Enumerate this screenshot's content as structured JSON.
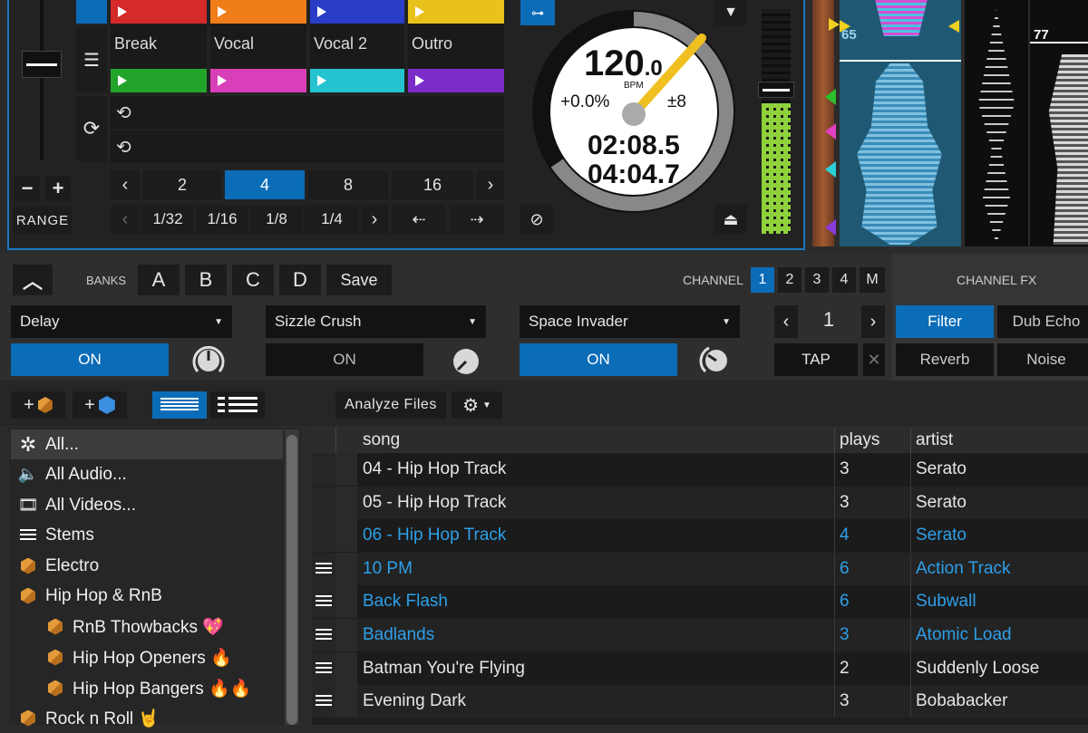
{
  "deck": {
    "cue_labels": [
      "Break",
      "Vocal",
      "Vocal 2",
      "Outro"
    ],
    "cue_colors": {
      "top": [
        "#d42a2a",
        "#f07d1a",
        "#2a3dc7",
        "#e8c21a"
      ],
      "bottom": [
        "#22a32a",
        "#d93fb8",
        "#24c3cf",
        "#7b2cc9"
      ]
    },
    "loop_sizes": [
      "2",
      "4",
      "8",
      "16"
    ],
    "loop_fractions": [
      "1/32",
      "1/16",
      "1/8",
      "1/4"
    ],
    "range_label": "RANGE",
    "minus_label": "−",
    "plus_label": "+",
    "bpm": "120",
    "bpm_decimal": ".0",
    "bpm_unit": "BPM",
    "pitch": "+0.0%",
    "pitch_range": "±8",
    "elapsed": "02:08.5",
    "remaining": "04:04.7"
  },
  "waveform": {
    "marker_left": "65",
    "marker_right": "77"
  },
  "fx": {
    "banks_label": "BANKS",
    "banks": [
      "A",
      "B",
      "C",
      "D"
    ],
    "save_label": "Save",
    "channel_label": "CHANNEL",
    "channels": [
      "1",
      "2",
      "3",
      "4",
      "M"
    ],
    "channel_fx_label": "CHANNEL FX",
    "units": [
      {
        "name": "Delay",
        "state": "ON",
        "active": true
      },
      {
        "name": "Sizzle Crush",
        "state": "ON",
        "active": false
      },
      {
        "name": "Space Invader",
        "state": "ON",
        "active": true
      }
    ],
    "beat_value": "1",
    "tap_label": "TAP",
    "channel_fx": [
      "Filter",
      "Dub Echo",
      "Reverb",
      "Noise"
    ]
  },
  "toolbar": {
    "analyze_label": "Analyze Files"
  },
  "library": {
    "items": [
      {
        "label": "All...",
        "icon": "asterisk-icon",
        "indent": 0
      },
      {
        "label": "All Audio...",
        "icon": "speaker-icon",
        "indent": 0
      },
      {
        "label": "All Videos...",
        "icon": "film-icon",
        "indent": 0
      },
      {
        "label": "Stems",
        "icon": "stems-icon",
        "indent": 0
      },
      {
        "label": "Electro",
        "icon": "crate-icon",
        "indent": 0
      },
      {
        "label": "Hip Hop & RnB",
        "icon": "crate-icon",
        "indent": 0
      },
      {
        "label": "RnB Thowbacks 💖",
        "icon": "crate-icon",
        "indent": 1
      },
      {
        "label": "Hip Hop Openers 🔥",
        "icon": "crate-icon",
        "indent": 1
      },
      {
        "label": "Hip Hop Bangers 🔥🔥",
        "icon": "crate-icon",
        "indent": 1
      },
      {
        "label": "Rock n Roll 🤘",
        "icon": "crate-icon",
        "indent": 0
      }
    ]
  },
  "tracks": {
    "headers": {
      "song": "song",
      "plays": "plays",
      "artist": "artist"
    },
    "rows": [
      {
        "song": "04 - Hip Hop Track",
        "plays": "3",
        "artist": "Serato",
        "highlight": false,
        "stems": false
      },
      {
        "song": "05 - Hip Hop Track",
        "plays": "3",
        "artist": "Serato",
        "highlight": false,
        "stems": false
      },
      {
        "song": "06 - Hip Hop Track",
        "plays": "4",
        "artist": "Serato",
        "highlight": true,
        "stems": false
      },
      {
        "song": "10 PM",
        "plays": "6",
        "artist": "Action Track",
        "highlight": true,
        "stems": true
      },
      {
        "song": "Back Flash",
        "plays": "6",
        "artist": "Subwall",
        "highlight": true,
        "stems": true
      },
      {
        "song": "Badlands",
        "plays": "3",
        "artist": "Atomic Load",
        "highlight": true,
        "stems": true
      },
      {
        "song": "Batman You're Flying",
        "plays": "2",
        "artist": "Suddenly Loose",
        "highlight": false,
        "stems": true
      },
      {
        "song": "Evening Dark",
        "plays": "3",
        "artist": "Bobabacker",
        "highlight": false,
        "stems": true
      }
    ]
  }
}
